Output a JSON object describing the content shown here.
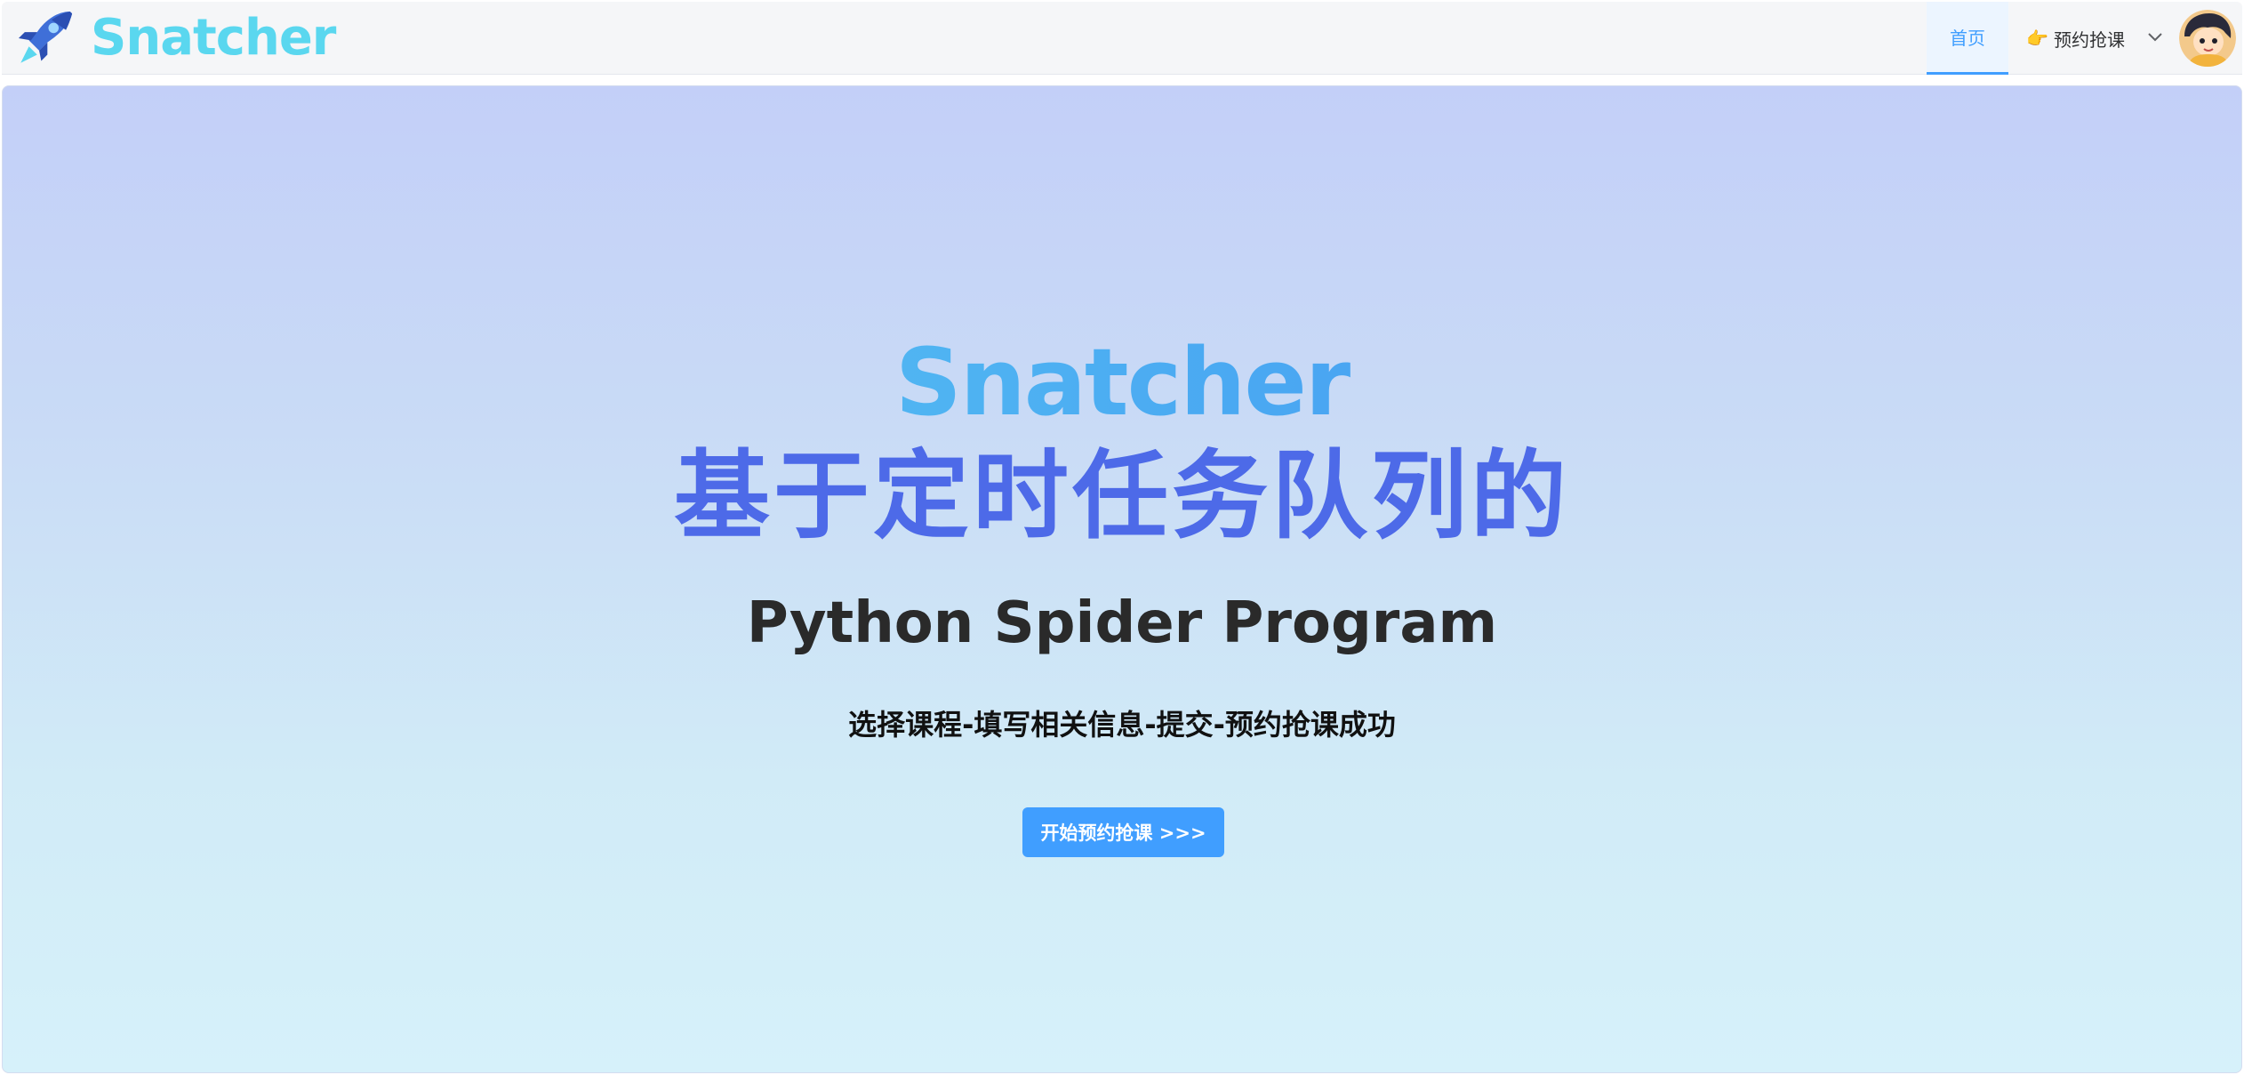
{
  "header": {
    "logo_text": "Snatcher",
    "logo_icon": "rocket-icon",
    "nav": {
      "home_label": "首页",
      "book_emoji": "👉",
      "book_label": "预约抢课",
      "dropdown_icon": "chevron-down-icon"
    },
    "avatar": "user-avatar"
  },
  "hero": {
    "brand": "Snatcher",
    "title": "基于定时任务队列的",
    "subtitle": "Python Spider Program",
    "steps": "选择课程-填写相关信息-提交-预约抢课成功",
    "cta_label": "开始预约抢课 >>>"
  },
  "colors": {
    "accent": "#409eff",
    "brand_cyan": "#5ad7ef",
    "title_blue": "#4d6ae8"
  }
}
